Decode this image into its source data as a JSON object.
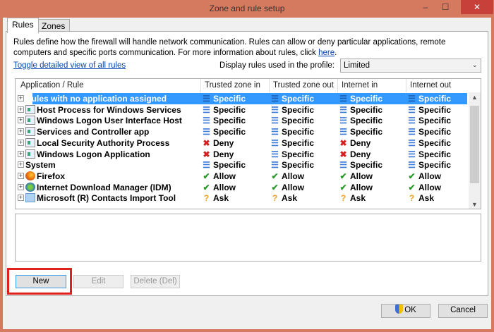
{
  "window": {
    "title": "Zone and rule setup"
  },
  "tabs": [
    {
      "label": "Rules",
      "active": true
    },
    {
      "label": "Zones",
      "active": false
    }
  ],
  "description": {
    "text": "Rules define how the firewall will handle network communication. Rules can allow or deny particular applications, remote computers and specific ports communication. For more information about rules, click ",
    "link": "here",
    "end": "."
  },
  "toggle_link": "Toggle detailed view of all rules",
  "profile": {
    "label": "Display rules used in the profile:",
    "value": "Limited"
  },
  "columns": [
    "Application / Rule",
    "Trusted zone in",
    "Trusted zone out",
    "Internet in",
    "Internet out"
  ],
  "rows": [
    {
      "name": "Rules with no application assigned",
      "icon": "none",
      "selected": true,
      "values": [
        "Specific",
        "Specific",
        "Specific",
        "Specific"
      ]
    },
    {
      "name": "Host Process for Windows Services",
      "icon": "app",
      "values": [
        "Specific",
        "Specific",
        "Specific",
        "Specific"
      ]
    },
    {
      "name": "Windows Logon User Interface Host",
      "icon": "app",
      "values": [
        "Specific",
        "Specific",
        "Specific",
        "Specific"
      ]
    },
    {
      "name": "Services and Controller app",
      "icon": "app",
      "values": [
        "Specific",
        "Specific",
        "Specific",
        "Specific"
      ]
    },
    {
      "name": "Local Security Authority Process",
      "icon": "app",
      "values": [
        "Deny",
        "Specific",
        "Deny",
        "Specific"
      ]
    },
    {
      "name": "Windows Logon Application",
      "icon": "app",
      "values": [
        "Deny",
        "Specific",
        "Deny",
        "Specific"
      ]
    },
    {
      "name": "System",
      "icon": "none",
      "values": [
        "Specific",
        "Specific",
        "Specific",
        "Specific"
      ]
    },
    {
      "name": "Firefox",
      "icon": "firefox",
      "values": [
        "Allow",
        "Allow",
        "Allow",
        "Allow"
      ]
    },
    {
      "name": "Internet Download Manager (IDM)",
      "icon": "idm",
      "values": [
        "Allow",
        "Allow",
        "Allow",
        "Allow"
      ]
    },
    {
      "name": "Microsoft (R) Contacts Import Tool",
      "icon": "contacts",
      "values": [
        "Ask",
        "Ask",
        "Ask",
        "Ask"
      ]
    }
  ],
  "buttons": {
    "new": "New",
    "edit": "Edit",
    "delete": "Delete (Del)",
    "ok": "OK",
    "cancel": "Cancel"
  },
  "colors": {
    "titlebar": "#d67a5f",
    "selection": "#3399ff",
    "highlight": "#e0201c"
  }
}
